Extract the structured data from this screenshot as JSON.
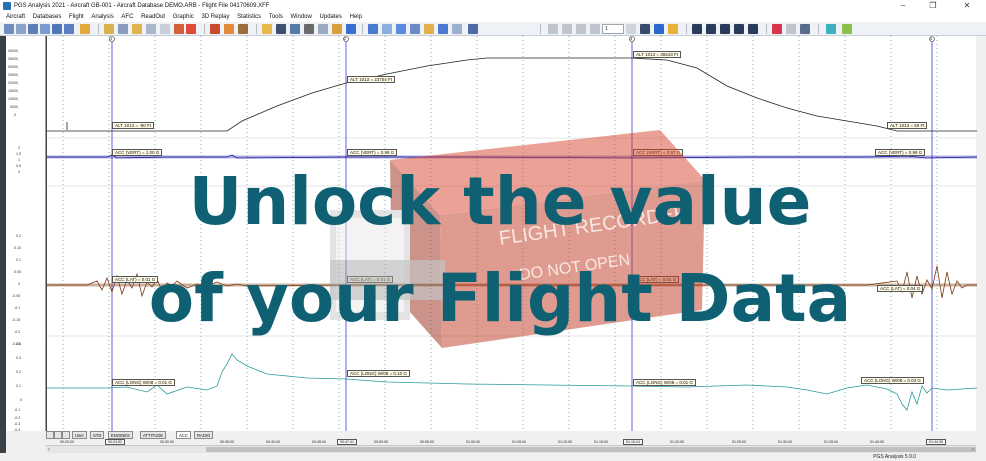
{
  "window": {
    "title": "PGS Analysis 2021 - Aircraft GB-001 - Aircraft Database DEMO.ARB - Flight File 04170609.XFF",
    "minimize": "–",
    "maximize": "❐",
    "close": "✕"
  },
  "menu": [
    "Aircraft",
    "Databases",
    "Flight",
    "Analysis",
    "AFC",
    "ReadOut",
    "Graphic",
    "3D Replay",
    "Statistics",
    "Tools",
    "Window",
    "Updates",
    "Help"
  ],
  "toolbar": {
    "page_value": "1"
  },
  "y_axis_ticks": {
    "alt": [
      "40000",
      "35000",
      "30000",
      "25000",
      "20000",
      "15000",
      "10000",
      "5000",
      "0"
    ],
    "acc_vert": [
      "2",
      "1.5",
      "1",
      "0.5",
      "0"
    ],
    "acc_lat": [
      "0.2",
      "0.15",
      "0.1",
      "0.05",
      "0",
      "-0.05",
      "-0.1",
      "-0.15",
      "-0.2",
      "-0.25"
    ],
    "acc_long": [
      "0.4",
      "0.3",
      "0.2",
      "0.1",
      "0",
      "-0.1",
      "-0.2",
      "-0.3",
      "-0.4"
    ]
  },
  "markers": [
    "1",
    "2",
    "3",
    "4"
  ],
  "labels": {
    "alt_1": "ALT 1013 = -80 Ft",
    "alt_2": "ALT 1013 = 23704 Ft",
    "alt_3": "ALT 1013 = 36543 Ft",
    "alt_4": "ALT 1013 = 60 Ft",
    "vert_1": "ACC (VERT) = 1.00 G",
    "vert_2": "ACC (VERT) = 0.99 G",
    "vert_3": "ACC (VERT) = 0.97 G",
    "vert_4": "ACC (VERT) = 0.99 G",
    "lat_1": "ACC (LAT) = 0.01 G",
    "lat_2": "ACC (LAT) = 0.01 G",
    "lat_3": "ACC (LAT) = 0.01 G",
    "lat_4": "ACC (LAT) = 0.04 G",
    "long_1": "ACC (LONG) W/08 = 0.01 G",
    "long_2": "ACC (LONG) W/08 = 0.10 G",
    "long_3": "ACC (LONG) W/08 = 0.01 G",
    "long_4": "ACC (LONG) W/08 = 0.03 G"
  },
  "tabs": [
    "User",
    "STD",
    "ENGINES",
    "ATTITUDE",
    "ACC",
    "RADIO"
  ],
  "active_tab": "ACC",
  "time_ticks": [
    "00:20:00",
    "00:25:00",
    "00:30:00",
    "00:35:00",
    "00:40:00",
    "00:45:00",
    "00:50:00",
    "00:55:00",
    "01:00:00",
    "01:05:00",
    "01:10:00",
    "01:15:00",
    "01:20:00",
    "01:25:00",
    "01:30:00",
    "01:35:00",
    "01:40:00",
    "01:45:00"
  ],
  "time_cursors": [
    "00:24:52",
    "00:47:41",
    "01:15:24",
    "01:44:35"
  ],
  "statusbar": {
    "version": "PGS Analysis 5.9.0"
  },
  "overlay": {
    "line1": "Unlock the value",
    "line2": "of your Flight Data",
    "color": "#0f6073"
  },
  "recorder": {
    "text_top": "FLIGHT RECORDER",
    "text_bottom": "DO NOT OPEN"
  },
  "colors": {
    "altitude": "#222222",
    "acc_vert": "#1a1aa0",
    "acc_lat": "#7a3a10",
    "acc_long": "#2a9a9a",
    "cursor": "#3a3ad8",
    "grid": "#3aa0a0"
  }
}
